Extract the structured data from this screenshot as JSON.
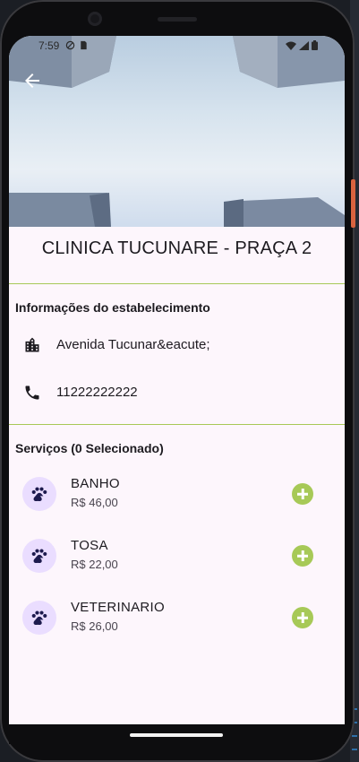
{
  "status_bar": {
    "time": "7:59"
  },
  "clinic": {
    "name": "CLINICA TUCUNARE - PRAÇA 2"
  },
  "info_section": {
    "title": "Informações do estabelecimento",
    "address": "Avenida Tucunar&eacute;",
    "phone": "11222222222"
  },
  "services_section": {
    "title": "Serviços (0 Selecionado)",
    "items": [
      {
        "name": "BANHO",
        "price": "R$ 46,00"
      },
      {
        "name": "TOSA",
        "price": "R$ 22,00"
      },
      {
        "name": "VETERINARIO",
        "price": "R$ 26,00"
      }
    ]
  },
  "colors": {
    "accent": "#a7c957",
    "avatar_bg": "#eaddff",
    "icon": "#1d1a4e",
    "background": "#fdf6fc"
  },
  "icons": {
    "back": "arrow-back-icon",
    "address": "building-icon",
    "phone": "phone-icon",
    "service": "paw-icon",
    "add": "add-circle-icon"
  }
}
